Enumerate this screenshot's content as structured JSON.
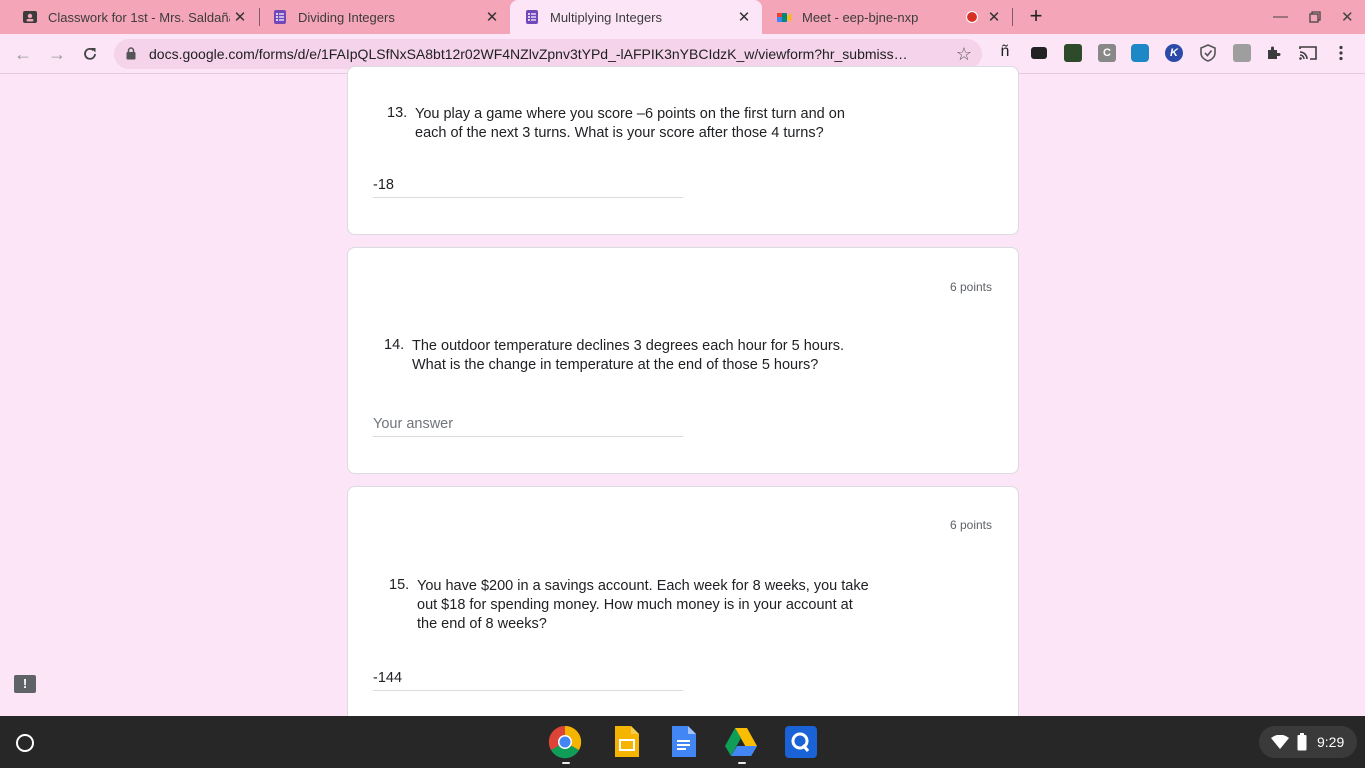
{
  "browser": {
    "tabs": [
      {
        "title": "Classwork for 1st - Mrs. Saldaña",
        "close": "✕"
      },
      {
        "title": "Dividing Integers",
        "close": "✕"
      },
      {
        "title": "Multiplying Integers",
        "close": "✕"
      },
      {
        "title": "Meet - eep-bjne-nxp",
        "close": "✕"
      }
    ],
    "url": "docs.google.com/forms/d/e/1FAIpQLSfNxSA8bt12r02WF4NZlvZpnv3tYPd_-lAFPIK3nYBCIdzK_w/viewform?hr_submiss…",
    "extensions": {
      "ext_n": "ñ",
      "ext_c": "C",
      "ext_k": "K"
    }
  },
  "form": {
    "questions": [
      {
        "number": "13.",
        "text_line1": "You play a game where you score –6 points on the first turn and on",
        "text_line2": "each of the next 3 turns. What is your score after those 4 turns?",
        "answer": "-18"
      },
      {
        "number": "14.",
        "points": "6 points",
        "text_line1": "The outdoor temperature declines 3 degrees each hour for 5 hours.",
        "text_line2": "What is the change in temperature at the end of those 5 hours?",
        "placeholder": "Your answer"
      },
      {
        "number": "15.",
        "points": "6 points",
        "text_line1": "You have $200 in a savings account. Each week for 8 weeks, you take",
        "text_line2": "out $18 for spending money. How much money is in your account at",
        "text_line3": "the end of 8 weeks?",
        "answer": "-144"
      }
    ],
    "feedback_glyph": "!"
  },
  "shelf": {
    "time": "9:29"
  },
  "colors": {
    "tabstrip": "#f4a5b8",
    "page_bg": "#fbe5f7",
    "forms_purple": "#7248b9"
  }
}
